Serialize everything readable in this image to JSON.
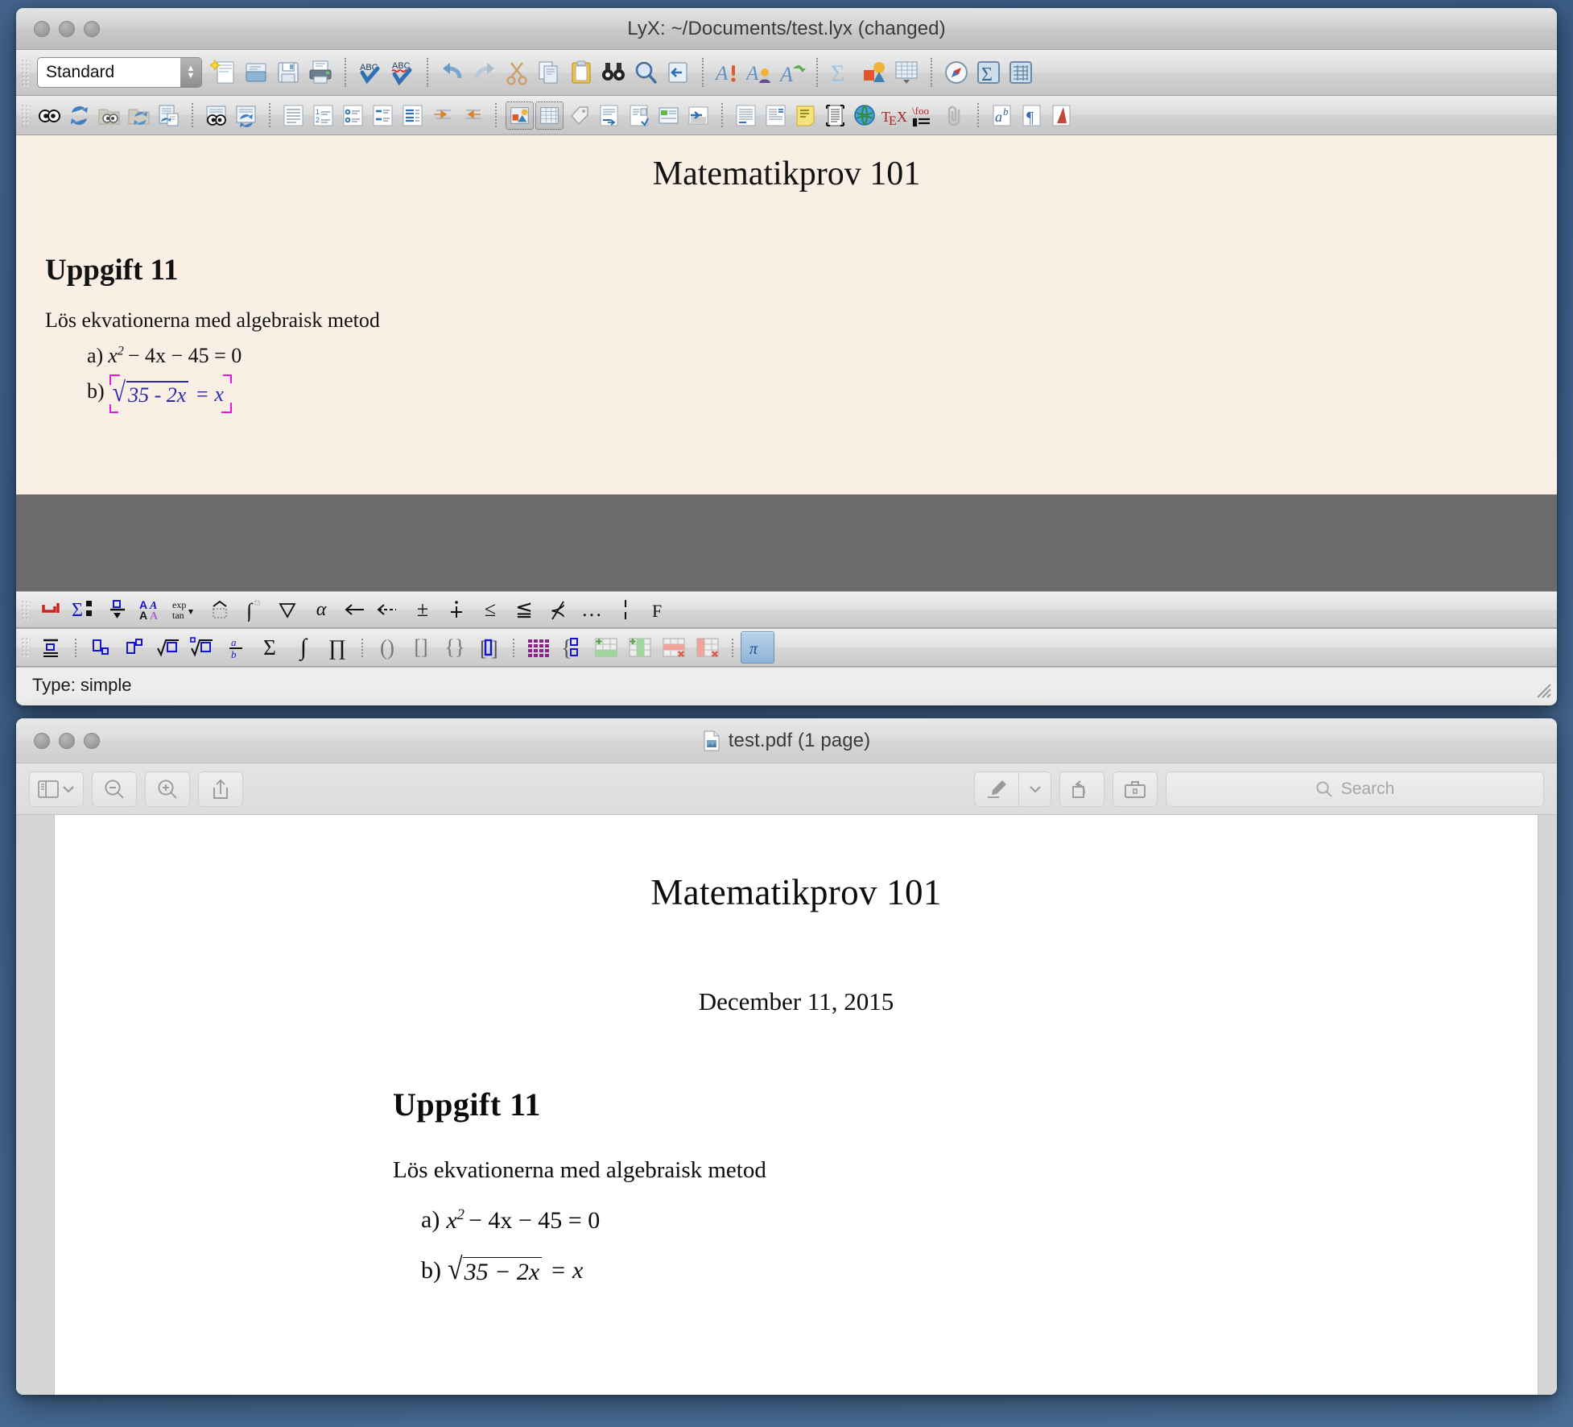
{
  "desktop": {
    "background_color": "#44658f"
  },
  "lyx_window": {
    "title": "LyX: ~/Documents/test.lyx (changed)",
    "traffic_lights": [
      "close-button",
      "minimize-button",
      "zoom-button"
    ],
    "style_combo": {
      "value": "Standard"
    },
    "toolbar_row1": [
      {
        "name": "new-document-button",
        "icon": "new-document-icon"
      },
      {
        "name": "open-document-button",
        "icon": "open-folder-icon"
      },
      {
        "name": "save-document-button",
        "icon": "floppy-disk-icon"
      },
      {
        "name": "print-document-button",
        "icon": "printer-icon"
      },
      {
        "name": "spellcheck-button",
        "icon": "abc-check-icon"
      },
      {
        "name": "thesaurus-button",
        "icon": "abc-squiggle-check-icon"
      },
      {
        "name": "undo-button",
        "icon": "undo-arrow-icon"
      },
      {
        "name": "redo-button",
        "icon": "redo-arrow-icon"
      },
      {
        "name": "cut-button",
        "icon": "scissors-icon"
      },
      {
        "name": "copy-button",
        "icon": "copy-pages-icon"
      },
      {
        "name": "paste-button",
        "icon": "clipboard-icon"
      },
      {
        "name": "find-replace-button",
        "icon": "binoculars-icon"
      },
      {
        "name": "zoom-button",
        "icon": "magnifier-icon"
      },
      {
        "name": "go-back-button",
        "icon": "back-arrow-icon"
      },
      {
        "name": "emphasis-style-button",
        "icon": "a-exclamation-icon"
      },
      {
        "name": "custom-text-style-button",
        "icon": "a-person-icon"
      },
      {
        "name": "apply-last-style-button",
        "icon": "a-green-arrow-icon"
      },
      {
        "name": "insert-math-button",
        "icon": "sigma-icon"
      },
      {
        "name": "insert-graphics-button",
        "icon": "shapes-icon"
      },
      {
        "name": "insert-table-button",
        "icon": "table-grid-icon"
      },
      {
        "name": "toggle-math-toolbar-button",
        "icon": "compass-icon"
      },
      {
        "name": "math-panel-button",
        "icon": "sigma-boxed-icon"
      },
      {
        "name": "table-panel-button",
        "icon": "table-boxed-icon"
      }
    ],
    "toolbar_row2": [
      {
        "name": "view-dvi-button",
        "icon": "eyes-icon"
      },
      {
        "name": "update-dvi-button",
        "icon": "blue-refresh-icon"
      },
      {
        "name": "view-other-formats-button",
        "icon": "folder-eyes-icon"
      },
      {
        "name": "update-other-formats-button",
        "icon": "folder-refresh-icon"
      },
      {
        "name": "view-master-button",
        "icon": "document-refresh-icon"
      },
      {
        "name": "view-master-document-button",
        "icon": "document-eyes-icon"
      },
      {
        "name": "update-master-document-button",
        "icon": "document-blue-refresh-icon"
      },
      {
        "name": "paragraph-standard-button",
        "icon": "lines-paragraph-icon"
      },
      {
        "name": "numbered-list-button",
        "icon": "numbered-list-icon"
      },
      {
        "name": "bulleted-list-button",
        "icon": "bulleted-list-icon"
      },
      {
        "name": "description-list-button",
        "icon": "description-list-icon"
      },
      {
        "name": "list-environment-button",
        "icon": "list-environment-icon"
      },
      {
        "name": "increase-depth-button",
        "icon": "indent-right-icon"
      },
      {
        "name": "decrease-depth-button",
        "icon": "indent-left-icon"
      },
      {
        "name": "insert-graphics-inset-button",
        "icon": "image-inset-icon"
      },
      {
        "name": "insert-table-inset-button",
        "icon": "table-inset-icon"
      },
      {
        "name": "insert-label-button",
        "icon": "tag-icon"
      },
      {
        "name": "insert-footnote-button",
        "icon": "footnote-icon"
      },
      {
        "name": "insert-marginal-note-button",
        "icon": "marginal-note-icon"
      },
      {
        "name": "insert-note-button",
        "icon": "green-note-icon"
      },
      {
        "name": "insert-box-button",
        "icon": "box-arrow-icon"
      },
      {
        "name": "insert-float-button",
        "icon": "float-lines-icon"
      },
      {
        "name": "insert-wrap-float-button",
        "icon": "wrap-float-icon"
      },
      {
        "name": "insert-yellow-note-button",
        "icon": "yellow-note-icon"
      },
      {
        "name": "insert-listing-button",
        "icon": "listing-icon"
      },
      {
        "name": "insert-hyperlink-button",
        "icon": "globe-link-icon"
      },
      {
        "name": "insert-tex-code-button",
        "icon": "tex-icon"
      },
      {
        "name": "insert-macro-button",
        "icon": "backslash-foo-icon"
      },
      {
        "name": "insert-file-button",
        "icon": "paperclip-icon"
      },
      {
        "name": "toggle-toolbar-button",
        "icon": "ab-superscript-icon"
      },
      {
        "name": "paragraph-settings-button",
        "icon": "pilcrow-icon"
      },
      {
        "name": "toggle-outline-button",
        "icon": "outline-icon"
      }
    ],
    "document": {
      "title": "Matematikprov 101",
      "section": "Uppgift 11",
      "paragraph": "Lös ekvationerna med algebraisk metod",
      "equation_a": {
        "label": "a)",
        "x": "x",
        "exponent": "2",
        "rest": "− 4x − 45 = 0"
      },
      "equation_b": {
        "label": "b)",
        "inside_sqrt": "35 - 2x",
        "after": "= x"
      },
      "background_color": "#f9efe4",
      "math_inset_color": "#2626b0",
      "math_inset_marker_color": "#e018e0"
    },
    "math_toolbar_row1": [
      {
        "name": "math-insert-newline-button",
        "icon": "newline-red-icon"
      },
      {
        "name": "math-sum-limits-button",
        "icon": "sigma-limits-icon"
      },
      {
        "name": "math-stack-button",
        "icon": "stack-above-below-icon"
      },
      {
        "name": "math-font-style-button",
        "icon": "aa-font-style-icon"
      },
      {
        "name": "math-functions-button",
        "icon": "exp-tan-icon"
      },
      {
        "name": "math-accent-button",
        "icon": "hat-accent-icon"
      },
      {
        "name": "math-integral-button",
        "icon": "integral-icon"
      },
      {
        "name": "math-nabla-button",
        "icon": "nabla-icon"
      },
      {
        "name": "math-greek-button",
        "icon": "alpha-icon"
      },
      {
        "name": "math-arrow-button",
        "icon": "left-arrow-icon"
      },
      {
        "name": "math-long-arrow-button",
        "icon": "dashed-left-arrow-icon"
      },
      {
        "name": "math-plusminus-button",
        "icon": "plus-minus-icon"
      },
      {
        "name": "math-dotplus-button",
        "icon": "dot-plus-icon"
      },
      {
        "name": "math-leq-button",
        "icon": "less-equal-icon"
      },
      {
        "name": "math-leqq-button",
        "icon": "less-equal-double-icon"
      },
      {
        "name": "math-negated-button",
        "icon": "not-relation-icon"
      },
      {
        "name": "math-dots-button",
        "icon": "ellipsis-icon"
      },
      {
        "name": "math-delimiter-bar-button",
        "icon": "vertical-bar-icon"
      },
      {
        "name": "math-frakture-button",
        "icon": "fraktur-f-icon"
      }
    ],
    "math_toolbar_row2": [
      {
        "name": "math-equation-align-button",
        "icon": "align-equation-icon"
      },
      {
        "name": "math-subscript-button",
        "icon": "subscript-icon"
      },
      {
        "name": "math-superscript-button",
        "icon": "superscript-icon"
      },
      {
        "name": "math-sqrt-button",
        "icon": "square-root-icon"
      },
      {
        "name": "math-nthroot-button",
        "icon": "nth-root-icon"
      },
      {
        "name": "math-fraction-button",
        "icon": "fraction-icon"
      },
      {
        "name": "math-sum-button",
        "icon": "sum-icon"
      },
      {
        "name": "math-integral-plain-button",
        "icon": "integral-plain-icon"
      },
      {
        "name": "math-product-button",
        "icon": "product-icon"
      },
      {
        "name": "math-parens-button",
        "icon": "parentheses-icon"
      },
      {
        "name": "math-brackets-button",
        "icon": "brackets-icon"
      },
      {
        "name": "math-braces-button",
        "icon": "braces-icon"
      },
      {
        "name": "math-delimiters-button",
        "icon": "delimiters-icon"
      },
      {
        "name": "math-matrix-button",
        "icon": "matrix-grid-icon"
      },
      {
        "name": "math-cases-button",
        "icon": "cases-icon"
      },
      {
        "name": "math-add-row-button",
        "icon": "add-row-icon"
      },
      {
        "name": "math-add-column-button",
        "icon": "add-column-icon"
      },
      {
        "name": "math-delete-row-button",
        "icon": "delete-row-icon"
      },
      {
        "name": "math-delete-column-button",
        "icon": "delete-column-icon"
      },
      {
        "name": "math-toggle-macro-button",
        "icon": "pi-boxed-icon"
      }
    ],
    "status_bar": {
      "text": "Type: simple"
    }
  },
  "pdf_window": {
    "title": "test.pdf (1 page)",
    "traffic_lights": [
      "close-button",
      "minimize-button",
      "zoom-button"
    ],
    "toolbar": {
      "sidebar_button": "sidebar-toggle-icon",
      "sidebar_dropdown": "chevron-down-icon",
      "zoom_out_button": "zoom-out-icon",
      "zoom_in_button": "zoom-in-icon",
      "share_button": "share-icon",
      "markup_button": "highlighter-pen-icon",
      "markup_dropdown": "chevron-down-icon",
      "rotate_button": "rotate-left-icon",
      "markup_toolbar_button": "toolbox-icon",
      "search_placeholder": "Search",
      "search_icon": "search-icon"
    },
    "document": {
      "title": "Matematikprov 101",
      "date": "December 11, 2015",
      "section": "Uppgift 11",
      "paragraph": "Lös ekvationerna med algebraisk metod",
      "equation_a": {
        "label": "a)",
        "x": "x",
        "exponent": "2",
        "rest": "− 4x − 45 = 0"
      },
      "equation_b": {
        "label": "b)",
        "inside_sqrt": "35 − 2x",
        "after": "= x"
      }
    }
  }
}
